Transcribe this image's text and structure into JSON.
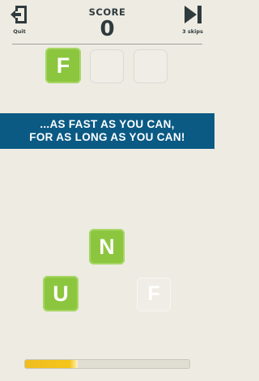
{
  "header": {
    "quit_label": "Quit",
    "score_title": "SCORE",
    "score_value": "0",
    "skips_label": "3 skips"
  },
  "word_slots": [
    {
      "letter": "F",
      "state": "filled"
    },
    {
      "letter": "",
      "state": "empty"
    },
    {
      "letter": "",
      "state": "empty"
    }
  ],
  "banner": {
    "line1": "...AS FAST AS YOU CAN,",
    "line2": "FOR AS LONG AS YOU CAN!"
  },
  "tiles": [
    {
      "letter": "N",
      "state": "active"
    },
    {
      "letter": "U",
      "state": "active"
    },
    {
      "letter": "F",
      "state": "used"
    }
  ],
  "timer": {
    "progress": 0.32
  },
  "colors": {
    "background": "#edebe2",
    "tile_green": "#8cc63f",
    "banner_blue": "#0a5a84",
    "timer_yellow": "#f5c51b",
    "text_dark": "#2f3a3d"
  },
  "icons": {
    "quit": "exit-door-icon",
    "skip": "skip-forward-icon"
  }
}
